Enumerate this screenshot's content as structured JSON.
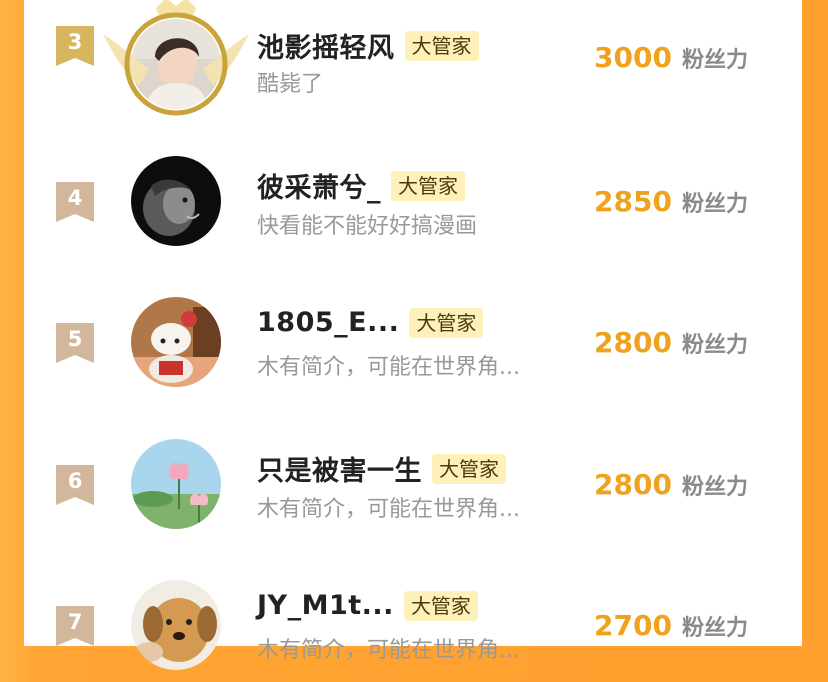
{
  "ranking": {
    "items": [
      {
        "rank": "3",
        "name": "池影摇轻风",
        "badge": "大管家",
        "bio": "酷毙了",
        "score": "3000",
        "unit": "粉丝力",
        "avatar_icon": "portrait-photo",
        "crown_frame": true,
        "rank_color": "#d8b660"
      },
      {
        "rank": "4",
        "name": "彼采萧兮_",
        "badge": "大管家",
        "bio": "快看能不能好好搞漫画",
        "score": "2850",
        "unit": "粉丝力",
        "avatar_icon": "lion-photo",
        "crown_frame": false,
        "rank_color": "#d3b79c"
      },
      {
        "rank": "5",
        "name": "1805_E...",
        "badge": "大管家",
        "bio": "木有简介，可能在世界角...",
        "score": "2800",
        "unit": "粉丝力",
        "avatar_icon": "hello-kitty-photo",
        "crown_frame": false,
        "rank_color": "#d3b79c"
      },
      {
        "rank": "6",
        "name": "只是被害一生",
        "badge": "大管家",
        "bio": "木有简介，可能在世界角...",
        "score": "2800",
        "unit": "粉丝力",
        "avatar_icon": "lotus-photo",
        "crown_frame": false,
        "rank_color": "#d3b79c"
      },
      {
        "rank": "7",
        "name": "JY_M1t...",
        "badge": "大管家",
        "bio": "木有简介，可能在世界角...",
        "score": "2700",
        "unit": "粉丝力",
        "avatar_icon": "dog-photo",
        "crown_frame": false,
        "rank_color": "#d3b79c"
      }
    ]
  },
  "colors": {
    "accent_orange": "#ffa533",
    "score": "#f0a21f",
    "badge_bg": "#fdf0b8",
    "gold_frame": "#c9a33c"
  }
}
